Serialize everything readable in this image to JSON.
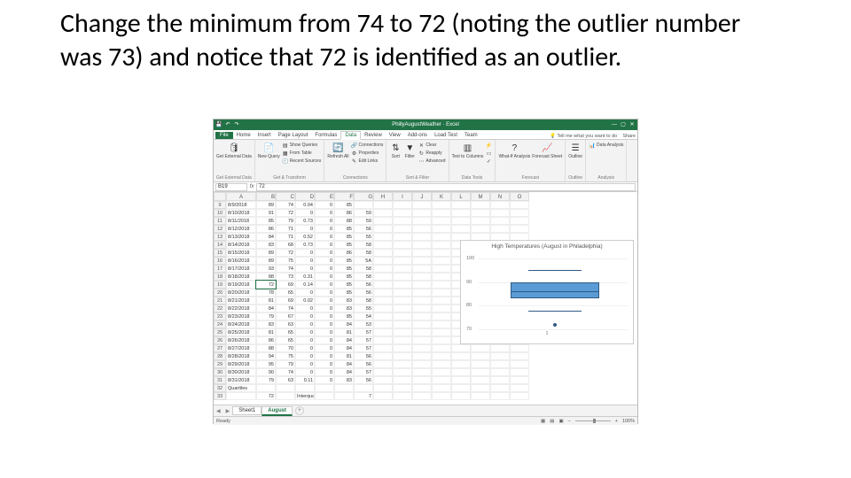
{
  "slide": {
    "text": "Change the minimum from 74 to 72 (noting the outlier number was 73) and notice that 72 is identified as an outlier."
  },
  "excel": {
    "title": "PhillyAugustWeather · Excel",
    "tabs": {
      "file": "File",
      "list": [
        "Home",
        "Insert",
        "Page Layout",
        "Formulas",
        "Data",
        "Review",
        "View",
        "Add-ons",
        "Load Test",
        "Team"
      ],
      "active": 4,
      "tell_me": "Tell me what you want to do",
      "share": "Share"
    },
    "ribbon": {
      "get_external_data": {
        "label": "Get External Data",
        "btn": "Get External\nData"
      },
      "get_transform": {
        "label": "Get & Transform",
        "new_query": "New\nQuery",
        "show_queries": "Show Queries",
        "from_table": "From Table",
        "recent_sources": "Recent Sources"
      },
      "connections": {
        "label": "Connections",
        "refresh": "Refresh\nAll",
        "connections": "Connections",
        "properties": "Properties",
        "edit_links": "Edit Links"
      },
      "sort_filter": {
        "label": "Sort & Filter",
        "sort": "Sort",
        "filter": "Filter",
        "clear": "Clear",
        "reapply": "Reapply",
        "advanced": "Advanced"
      },
      "data_tools": {
        "label": "Data Tools",
        "text_to_cols": "Text to\nColumns"
      },
      "forecast": {
        "label": "Forecast",
        "whatif": "What-If\nAnalysis",
        "sheet": "Forecast\nSheet"
      },
      "outline": {
        "label": "Outline",
        "btn": "Outline"
      },
      "analysis": {
        "label": "Analysis",
        "data_analysis": "Data Analysis"
      }
    },
    "namebox": "B19",
    "formula_value": "72",
    "columns": [
      "A",
      "B",
      "C",
      "D",
      "E",
      "F",
      "G",
      "H",
      "I",
      "J",
      "K",
      "L",
      "M",
      "N",
      "O"
    ],
    "selected_cell": {
      "row": 19,
      "col": "B"
    },
    "rows": [
      {
        "n": 9,
        "a": "8/9/2018",
        "b": 89,
        "c": 74,
        "d": "0.04",
        "e": 0,
        "f": 85,
        "g": ""
      },
      {
        "n": 10,
        "a": "8/10/2018",
        "b": 91,
        "c": 72,
        "d": "0",
        "e": 0,
        "f": 86,
        "g": 59
      },
      {
        "n": 11,
        "a": "8/11/2018",
        "b": 85,
        "c": 79,
        "d": "0.73",
        "e": 0,
        "f": 88,
        "g": 59
      },
      {
        "n": 12,
        "a": "8/12/2018",
        "b": 86,
        "c": 71,
        "d": "0",
        "e": 0,
        "f": 85,
        "g": 56
      },
      {
        "n": 13,
        "a": "8/13/2018",
        "b": 84,
        "c": 71,
        "d": "0.52",
        "e": 0,
        "f": 85,
        "g": 55
      },
      {
        "n": 14,
        "a": "8/14/2018",
        "b": 83,
        "c": 68,
        "d": "0.73",
        "e": 0,
        "f": 85,
        "g": 58
      },
      {
        "n": 15,
        "a": "8/15/2018",
        "b": 89,
        "c": 72,
        "d": "0",
        "e": 0,
        "f": 86,
        "g": 58
      },
      {
        "n": 16,
        "a": "8/16/2018",
        "b": 89,
        "c": 75,
        "d": "0",
        "e": 0,
        "f": 85,
        "g": "5A"
      },
      {
        "n": 17,
        "a": "8/17/2018",
        "b": 93,
        "c": 74,
        "d": "0",
        "e": 0,
        "f": 85,
        "g": 58
      },
      {
        "n": 18,
        "a": "8/18/2018",
        "b": 88,
        "c": 73,
        "d": "0.31",
        "e": 0,
        "f": 85,
        "g": 58
      },
      {
        "n": 19,
        "a": "8/19/2018",
        "b": 72,
        "c": 69,
        "d": "0.14",
        "e": 0,
        "f": 85,
        "g": 56
      },
      {
        "n": 20,
        "a": "8/20/2018",
        "b": 78,
        "c": 65,
        "d": "0",
        "e": 0,
        "f": 85,
        "g": 56
      },
      {
        "n": 21,
        "a": "8/21/2018",
        "b": 81,
        "c": 69,
        "d": "0.02",
        "e": 0,
        "f": 83,
        "g": 58
      },
      {
        "n": 22,
        "a": "8/22/2018",
        "b": 84,
        "c": 74,
        "d": "0",
        "e": 0,
        "f": 83,
        "g": 55
      },
      {
        "n": 23,
        "a": "8/23/2018",
        "b": 79,
        "c": 67,
        "d": "0",
        "e": 0,
        "f": 85,
        "g": 54
      },
      {
        "n": 24,
        "a": "8/24/2018",
        "b": 83,
        "c": 63,
        "d": "0",
        "e": 0,
        "f": 84,
        "g": 53
      },
      {
        "n": 25,
        "a": "8/25/2018",
        "b": 81,
        "c": 65,
        "d": "0",
        "e": 0,
        "f": 81,
        "g": 57
      },
      {
        "n": 26,
        "a": "8/26/2018",
        "b": 86,
        "c": 65,
        "d": "0",
        "e": 0,
        "f": 84,
        "g": 57
      },
      {
        "n": 27,
        "a": "8/27/2018",
        "b": 88,
        "c": 70,
        "d": "0",
        "e": 0,
        "f": 84,
        "g": 57
      },
      {
        "n": 28,
        "a": "8/28/2018",
        "b": 94,
        "c": 75,
        "d": "0",
        "e": 0,
        "f": 81,
        "g": 56
      },
      {
        "n": 29,
        "a": "8/29/2018",
        "b": 95,
        "c": 79,
        "d": "0",
        "e": 0,
        "f": 84,
        "g": 56
      },
      {
        "n": 30,
        "a": "8/30/2018",
        "b": 90,
        "c": 74,
        "d": "0",
        "e": 0,
        "f": 84,
        "g": 57
      },
      {
        "n": 31,
        "a": "8/31/2018",
        "b": 79,
        "c": 63,
        "d": "0.11",
        "e": 0,
        "f": 83,
        "g": 56
      },
      {
        "n": 32,
        "a": "Quartiles",
        "b": "",
        "c": "",
        "d": "",
        "e": "",
        "f": "",
        "g": ""
      },
      {
        "n": 33,
        "a": "",
        "b": 72,
        "c": "",
        "d": "Interquartile range",
        "e": "",
        "f": "",
        "g": 7
      }
    ],
    "chart_data": {
      "type": "box",
      "title": "High Temperatures (August in Philadelphia)",
      "ylim": [
        70,
        100
      ],
      "yticks": [
        70,
        80,
        90,
        100
      ],
      "series": [
        {
          "name": "1",
          "min": 78,
          "q1": 83,
          "median": 86,
          "q3": 90,
          "max": 95,
          "outliers": [
            72
          ]
        }
      ],
      "xlabel": "1"
    },
    "sheets": {
      "list": [
        "Sheet1",
        "August"
      ],
      "active": 1
    },
    "status": {
      "mode": "Ready",
      "zoom": "100%",
      "zoom_plus": "+",
      "zoom_minus": "–",
      "views": [
        "▦",
        "▤",
        "▣"
      ]
    }
  }
}
